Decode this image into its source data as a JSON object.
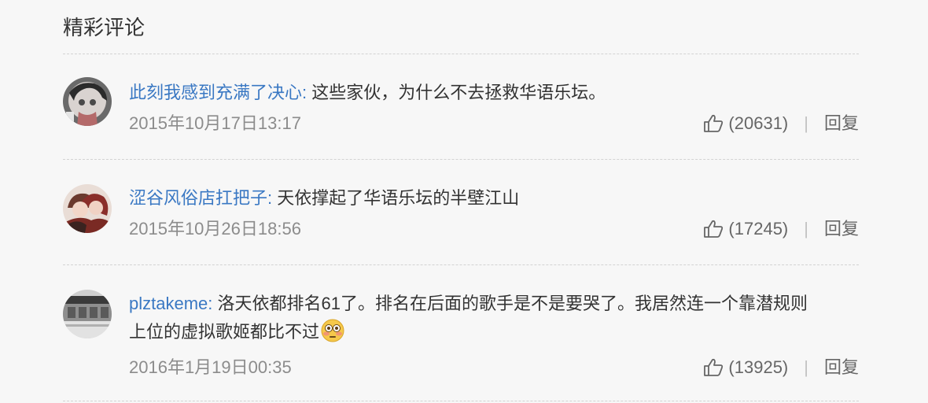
{
  "section": {
    "title": "精彩评论"
  },
  "comments": [
    {
      "username": "此刻我感到充满了决心",
      "separator": ": ",
      "content": "这些家伙，为什么不去拯救华语乐坛。",
      "time": "2015年10月17日13:17",
      "likes": "(20631)",
      "reply_label": "回复",
      "avatar_icon": "anime-avatar-icon"
    },
    {
      "username": "涩谷风俗店扛把子",
      "separator": ": ",
      "content": "天依撑起了华语乐坛的半壁江山",
      "time": "2015年10月26日18:56",
      "likes": "(17245)",
      "reply_label": "回复",
      "avatar_icon": "anime-couple-avatar-icon"
    },
    {
      "username": "plztakeme",
      "separator": ": ",
      "content": "洛天依都排名61了。排名在后面的歌手是不是要哭了。我居然连一个靠潜规则上位的虚拟歌姬都比不过",
      "time": "2016年1月19日00:35",
      "likes": "(13925)",
      "reply_label": "回复",
      "avatar_icon": "building-avatar-icon",
      "emoji": "flushed-face-emoji"
    }
  ],
  "divider_char": "|",
  "colors": {
    "username": "#3a78c3",
    "text": "#333333",
    "meta": "#8c8c8c",
    "background": "#f7f7f7"
  }
}
